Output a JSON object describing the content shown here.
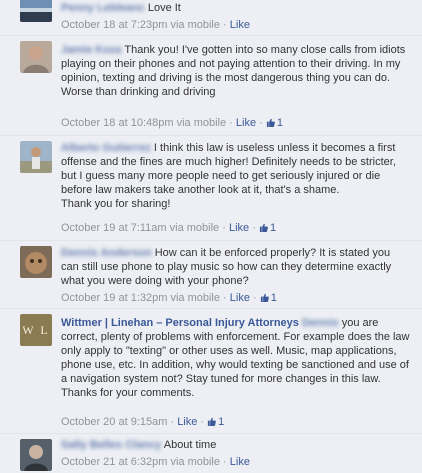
{
  "comments": [
    {
      "author": "Penny Lebleanc",
      "text": "Love It",
      "time": "October 18 at 7:23pm",
      "via": "via mobile",
      "like_label": "Like",
      "likes": ""
    },
    {
      "author": "Jamie Koza",
      "text": "Thank you! I've gotten into so many close calls from idiots playing on their phones and not paying attention to their driving. In my opinion, texting and driving is the most dangerous thing you can do. Worse than drinking and driving",
      "time": "October 18 at 10:48pm",
      "via": "via mobile",
      "like_label": "Like",
      "likes": "1"
    },
    {
      "author": "Alberto Gutierrez",
      "text": "I think this law is useless unless it becomes a first offense and the fines are much higher! Definitely needs to be stricter, but I guess many more people need to get seriously injured or die before law makers take another look at it, that's a shame.\nThank you for sharing!",
      "time": "October 19 at 7:11am",
      "via": "via mobile",
      "like_label": "Like",
      "likes": "1"
    },
    {
      "author": "Dennis Anderson",
      "text": "How can it be enforced properly? It is stated you can still use phone to play music so how can they determine exactly what you were doing with your phone?",
      "time": "October 19 at 1:32pm",
      "via": "via mobile",
      "like_label": "Like",
      "likes": "1"
    },
    {
      "author": "Wittmer | Linehan – Personal Injury Attorneys",
      "author_tail": "Dennis",
      "text": "you are correct, plenty of problems with enforcement. For example does the law only apply to \"texting\" or other uses as well. Music, map applications, phone use, etc. In addition, why would texting be sanctioned and use of a navigation system not? Stay tuned for more changes in this law. Thanks for your comments.",
      "time": "October 20 at 9:15am",
      "via": "",
      "like_label": "Like",
      "likes": "1",
      "logo_text": "W L"
    },
    {
      "author": "Sally Belles Clancy",
      "text": "About time",
      "time": "October 21 at 6:32pm",
      "via": "via mobile",
      "like_label": "Like",
      "likes": ""
    }
  ],
  "colors": {
    "background": "#edeff4",
    "link": "#3b5998",
    "meta": "#90949c",
    "logo_bg": "#8b7a52"
  }
}
